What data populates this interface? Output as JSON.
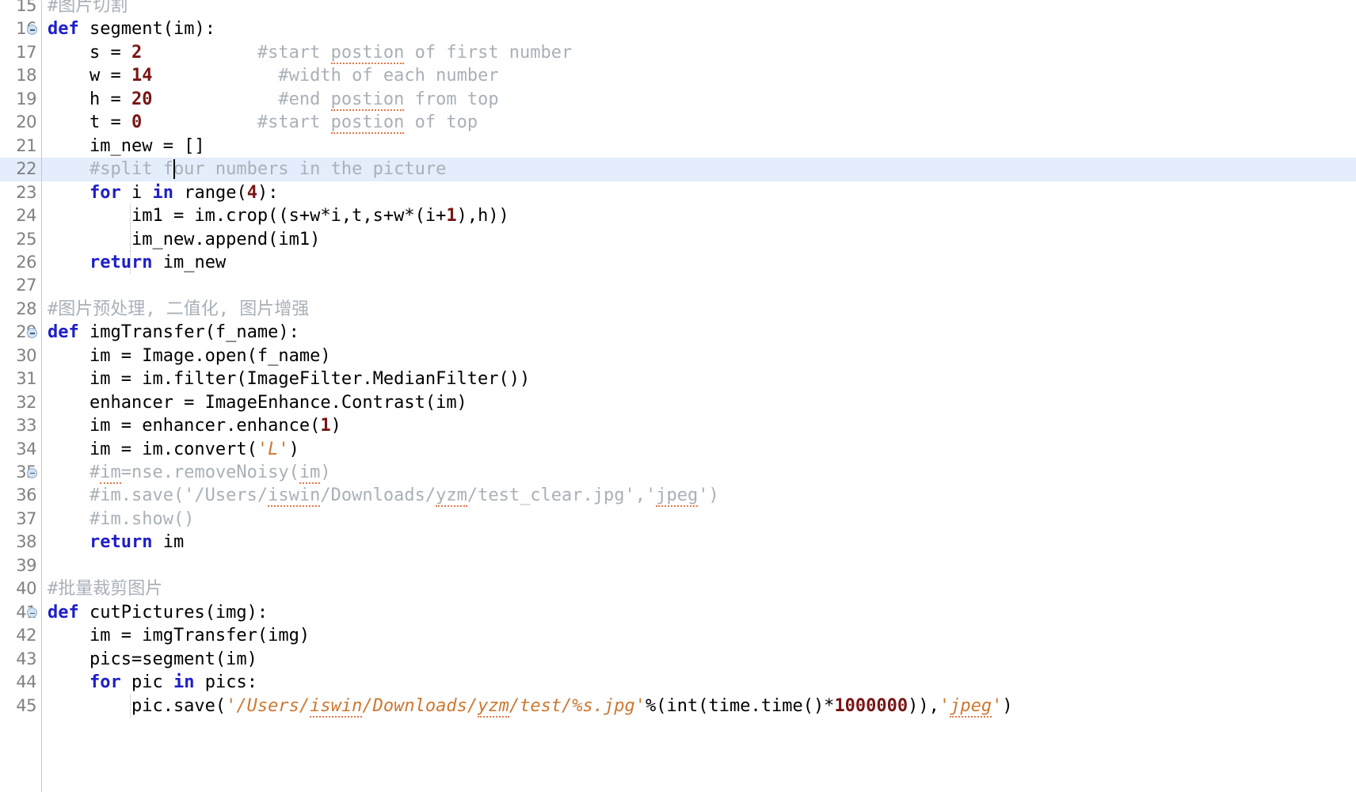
{
  "editor": {
    "kind": "python-source-editor",
    "language": "Python",
    "theme": "light",
    "font_family": "monospace",
    "colors": {
      "background": "#ffffff",
      "active_line": "#e3edfb",
      "gutter_text": "#808080",
      "gutter_separator": "#c8c8c8",
      "keyword": "#1f1fc8",
      "number": "#7a1414",
      "string": "#cc7832",
      "comment": "#a9b0b8",
      "plain_text": "#000000",
      "spellcheck_underline": "#e05a2b",
      "fold_marker": "#d3e2f2",
      "indent_guide": "#b4b4b4"
    },
    "active_line_number": 22,
    "caret": {
      "line": 22,
      "column_char": 12
    },
    "first_visible_line": 15,
    "last_visible_line": 45
  },
  "lines": [
    {
      "number": "15",
      "fold": false,
      "active": false,
      "text": "#图片切割",
      "tokens": [
        {
          "t": "cmt",
          "v": "#图片切割"
        }
      ]
    },
    {
      "number": "16",
      "fold": true,
      "active": false,
      "text": "def segment(im):",
      "tokens": [
        {
          "t": "kw",
          "v": "def"
        },
        {
          "t": "plain",
          "v": " segment(im):"
        }
      ]
    },
    {
      "number": "17",
      "fold": false,
      "active": false,
      "text": "    s = 2           #start postion of first number",
      "tokens": [
        {
          "t": "plain",
          "v": "    s = "
        },
        {
          "t": "num",
          "v": "2"
        },
        {
          "t": "cmt",
          "v": "           #start "
        },
        {
          "t": "cmt-sp",
          "v": "postion"
        },
        {
          "t": "cmt",
          "v": " of first number"
        }
      ]
    },
    {
      "number": "18",
      "fold": false,
      "active": false,
      "text": "    w = 14           #width of each number",
      "tokens": [
        {
          "t": "plain",
          "v": "    w = "
        },
        {
          "t": "num",
          "v": "14"
        },
        {
          "t": "cmt",
          "v": "            #width of each number"
        }
      ]
    },
    {
      "number": "19",
      "fold": false,
      "active": false,
      "text": "    h = 20           #end postion from top",
      "tokens": [
        {
          "t": "plain",
          "v": "    h = "
        },
        {
          "t": "num",
          "v": "20"
        },
        {
          "t": "cmt",
          "v": "            #end "
        },
        {
          "t": "cmt-sp",
          "v": "postion"
        },
        {
          "t": "cmt",
          "v": " from top"
        }
      ]
    },
    {
      "number": "20",
      "fold": false,
      "active": false,
      "text": "    t = 0           #start postion of top",
      "tokens": [
        {
          "t": "plain",
          "v": "    t = "
        },
        {
          "t": "num",
          "v": "0"
        },
        {
          "t": "cmt",
          "v": "           #start "
        },
        {
          "t": "cmt-sp",
          "v": "postion"
        },
        {
          "t": "cmt",
          "v": " of top"
        }
      ]
    },
    {
      "number": "21",
      "fold": false,
      "active": false,
      "text": "    im_new = []",
      "tokens": [
        {
          "t": "plain",
          "v": "    im_new = []"
        }
      ]
    },
    {
      "number": "22",
      "fold": false,
      "active": true,
      "text": "    #split four numbers in the picture",
      "tokens": [
        {
          "t": "cmt",
          "v": "    #split four numbers in the picture"
        }
      ]
    },
    {
      "number": "23",
      "fold": false,
      "active": false,
      "text": "    for i in range(4):",
      "tokens": [
        {
          "t": "plain",
          "v": "    "
        },
        {
          "t": "kw",
          "v": "for"
        },
        {
          "t": "plain",
          "v": " i "
        },
        {
          "t": "kw",
          "v": "in"
        },
        {
          "t": "plain",
          "v": " range("
        },
        {
          "t": "num",
          "v": "4"
        },
        {
          "t": "plain",
          "v": "):"
        }
      ]
    },
    {
      "number": "24",
      "fold": false,
      "active": false,
      "text": "        im1 = im.crop((s+w*i,t,s+w*(i+1),h))",
      "tokens": [
        {
          "t": "plain",
          "v": "        im1 = im.crop((s+w*i,t,s+w*(i+"
        },
        {
          "t": "num",
          "v": "1"
        },
        {
          "t": "plain",
          "v": "),h))"
        }
      ]
    },
    {
      "number": "25",
      "fold": false,
      "active": false,
      "text": "        im_new.append(im1)",
      "tokens": [
        {
          "t": "plain",
          "v": "        im_new.append(im1)"
        }
      ]
    },
    {
      "number": "26",
      "fold": false,
      "active": false,
      "text": "    return im_new",
      "tokens": [
        {
          "t": "plain",
          "v": "    "
        },
        {
          "t": "kw",
          "v": "return"
        },
        {
          "t": "plain",
          "v": " im_new"
        }
      ]
    },
    {
      "number": "27",
      "fold": false,
      "active": false,
      "text": "",
      "tokens": []
    },
    {
      "number": "28",
      "fold": false,
      "active": false,
      "text": "#图片预处理, 二值化, 图片增强",
      "tokens": [
        {
          "t": "cmt",
          "v": "#图片预处理, 二值化, 图片增强"
        }
      ]
    },
    {
      "number": "29",
      "fold": true,
      "active": false,
      "text": "def imgTransfer(f_name):",
      "tokens": [
        {
          "t": "kw",
          "v": "def"
        },
        {
          "t": "plain",
          "v": " imgTransfer(f_name):"
        }
      ]
    },
    {
      "number": "30",
      "fold": false,
      "active": false,
      "text": "    im = Image.open(f_name)",
      "tokens": [
        {
          "t": "plain",
          "v": "    im = Image.open(f_name)"
        }
      ]
    },
    {
      "number": "31",
      "fold": false,
      "active": false,
      "text": "    im = im.filter(ImageFilter.MedianFilter())",
      "tokens": [
        {
          "t": "plain",
          "v": "    im = im.filter(ImageFilter.MedianFilter())"
        }
      ]
    },
    {
      "number": "32",
      "fold": false,
      "active": false,
      "text": "    enhancer = ImageEnhance.Contrast(im)",
      "tokens": [
        {
          "t": "plain",
          "v": "    enhancer = ImageEnhance.Contrast(im)"
        }
      ]
    },
    {
      "number": "33",
      "fold": false,
      "active": false,
      "text": "    im = enhancer.enhance(1)",
      "tokens": [
        {
          "t": "plain",
          "v": "    im = enhancer.enhance("
        },
        {
          "t": "num",
          "v": "1"
        },
        {
          "t": "plain",
          "v": ")"
        }
      ]
    },
    {
      "number": "34",
      "fold": false,
      "active": false,
      "text": "    im = im.convert('L')",
      "tokens": [
        {
          "t": "plain",
          "v": "    im = im.convert("
        },
        {
          "t": "str",
          "v": "'L'"
        },
        {
          "t": "plain",
          "v": ")"
        }
      ]
    },
    {
      "number": "35",
      "fold": true,
      "active": false,
      "text": "    #im=nse.removeNoisy(im)",
      "tokens": [
        {
          "t": "cmt",
          "v": "    #"
        },
        {
          "t": "cmt-sp",
          "v": "im"
        },
        {
          "t": "cmt",
          "v": "=nse.removeNoisy("
        },
        {
          "t": "cmt-sp",
          "v": "im"
        },
        {
          "t": "cmt",
          "v": ")"
        }
      ]
    },
    {
      "number": "36",
      "fold": false,
      "active": false,
      "text": "    #im.save('/Users/iswin/Downloads/yzm/test_clear.jpg','jpeg')",
      "tokens": [
        {
          "t": "cmt",
          "v": "    #im.save('/Users/"
        },
        {
          "t": "cmt-sp",
          "v": "iswin"
        },
        {
          "t": "cmt",
          "v": "/Downloads/"
        },
        {
          "t": "cmt-sp",
          "v": "yzm"
        },
        {
          "t": "cmt",
          "v": "/test_clear.jpg','"
        },
        {
          "t": "cmt-sp",
          "v": "jpeg"
        },
        {
          "t": "cmt",
          "v": "')"
        }
      ]
    },
    {
      "number": "37",
      "fold": false,
      "active": false,
      "text": "    #im.show()",
      "tokens": [
        {
          "t": "cmt",
          "v": "    #im.show()"
        }
      ]
    },
    {
      "number": "38",
      "fold": false,
      "active": false,
      "text": "    return im",
      "tokens": [
        {
          "t": "plain",
          "v": "    "
        },
        {
          "t": "kw",
          "v": "return"
        },
        {
          "t": "plain",
          "v": " im"
        }
      ]
    },
    {
      "number": "39",
      "fold": false,
      "active": false,
      "text": "",
      "tokens": []
    },
    {
      "number": "40",
      "fold": false,
      "active": false,
      "text": "#批量裁剪图片",
      "tokens": [
        {
          "t": "cmt",
          "v": "#批量裁剪图片"
        }
      ]
    },
    {
      "number": "41",
      "fold": true,
      "active": false,
      "text": "def cutPictures(img):",
      "tokens": [
        {
          "t": "kw",
          "v": "def"
        },
        {
          "t": "plain",
          "v": " cutPictures(img):"
        }
      ]
    },
    {
      "number": "42",
      "fold": false,
      "active": false,
      "text": "    im = imgTransfer(img)",
      "tokens": [
        {
          "t": "plain",
          "v": "    im = imgTransfer(img)"
        }
      ]
    },
    {
      "number": "43",
      "fold": false,
      "active": false,
      "text": "    pics=segment(im)",
      "tokens": [
        {
          "t": "plain",
          "v": "    pics=segment(im)"
        }
      ]
    },
    {
      "number": "44",
      "fold": false,
      "active": false,
      "text": "    for pic in pics:",
      "tokens": [
        {
          "t": "plain",
          "v": "    "
        },
        {
          "t": "kw",
          "v": "for"
        },
        {
          "t": "plain",
          "v": " pic "
        },
        {
          "t": "kw",
          "v": "in"
        },
        {
          "t": "plain",
          "v": " pics:"
        }
      ]
    },
    {
      "number": "45",
      "fold": false,
      "active": false,
      "text": "        pic.save('/Users/iswin/Downloads/yzm/test/%s.jpg'%(int(time.time()*1000000)),'jpeg')",
      "tokens": [
        {
          "t": "plain",
          "v": "        pic.save("
        },
        {
          "t": "str",
          "v": "'/Users/"
        },
        {
          "t": "str-sp",
          "v": "iswin"
        },
        {
          "t": "str",
          "v": "/Downloads/"
        },
        {
          "t": "str-sp",
          "v": "yzm"
        },
        {
          "t": "str",
          "v": "/test/%s.jpg'"
        },
        {
          "t": "plain",
          "v": "%(int(time.time()*"
        },
        {
          "t": "num",
          "v": "1000000"
        },
        {
          "t": "plain",
          "v": ")),"
        },
        {
          "t": "str",
          "v": "'"
        },
        {
          "t": "str-sp",
          "v": "jpeg"
        },
        {
          "t": "str",
          "v": "'"
        },
        {
          "t": "plain",
          "v": ")"
        }
      ]
    }
  ],
  "indent_guides": [
    {
      "line": "24",
      "levels": [
        2
      ]
    },
    {
      "line": "25",
      "levels": [
        2
      ]
    },
    {
      "line": "26",
      "levels": [
        2
      ]
    },
    {
      "line": "45",
      "levels": [
        2
      ]
    }
  ]
}
